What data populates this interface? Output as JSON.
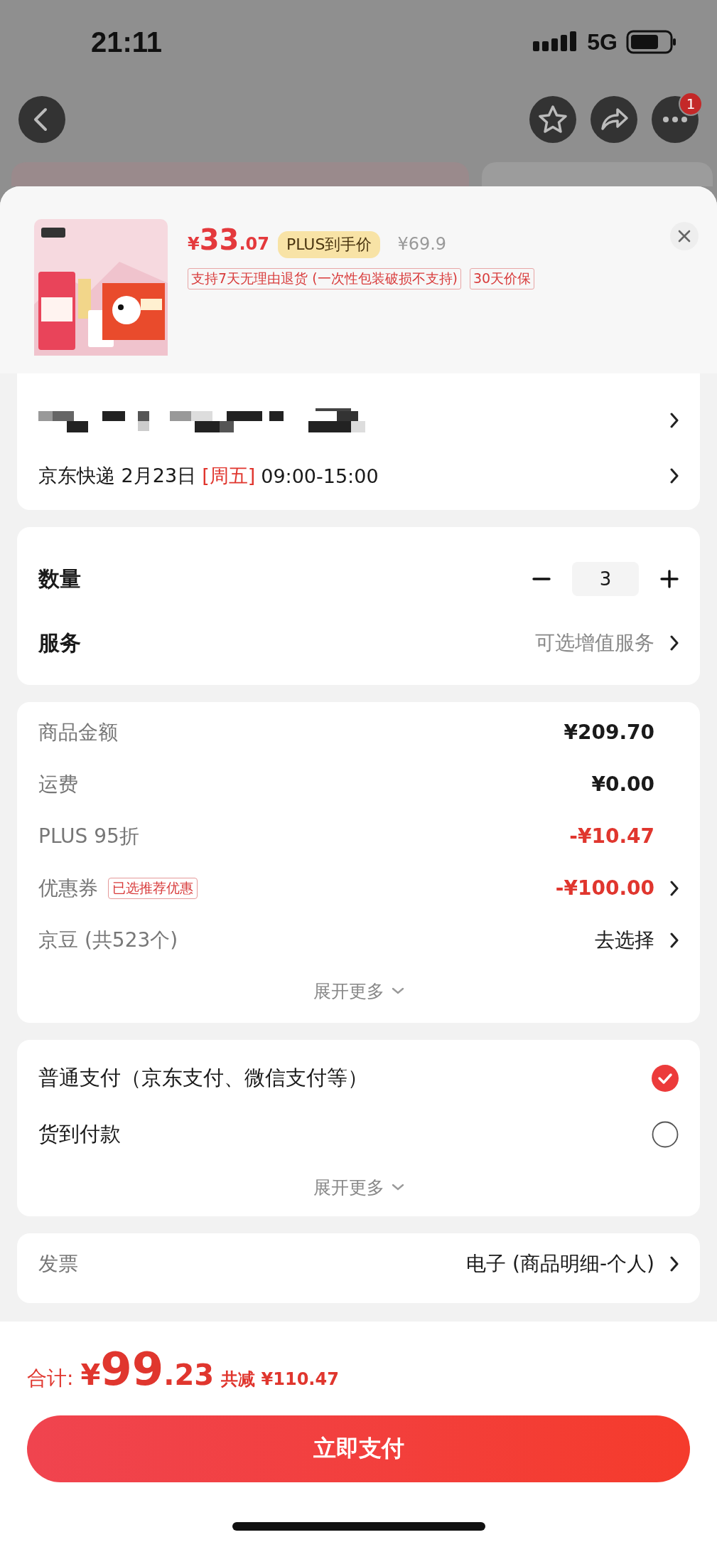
{
  "status_bar": {
    "time": "21:11",
    "network": "5G"
  },
  "nav": {
    "notification_badge": "1"
  },
  "product": {
    "currency": "¥",
    "price_integer": "33",
    "price_decimal": ".07",
    "price_label": "PLUS到手价",
    "original_price": "¥69.9",
    "tags": [
      "支持7天无理由退货 (一次性包装破损不支持)",
      "30天价保"
    ]
  },
  "delivery": {
    "carrier_date": "京东快递 2月23日",
    "weekday": "[周五]",
    "time_window": "09:00-15:00"
  },
  "quantity": {
    "label": "数量",
    "value": "3"
  },
  "service": {
    "label": "服务",
    "value": "可选增值服务"
  },
  "price_rows": [
    {
      "label": "商品金额",
      "value": "¥209.70",
      "kind": "amount",
      "chevron": false
    },
    {
      "label": "运费",
      "value": "¥0.00",
      "kind": "amount",
      "chevron": false
    },
    {
      "label": "PLUS 95折",
      "value": "-¥10.47",
      "kind": "deduction",
      "chevron": false
    },
    {
      "label": "优惠券",
      "badge": "已选推荐优惠",
      "value": "-¥100.00",
      "kind": "deduction",
      "chevron": true
    },
    {
      "label": "京豆 (共523个)",
      "value": "去选择",
      "kind": "choice",
      "chevron": true
    }
  ],
  "price_expand": "展开更多",
  "payment_options": [
    {
      "label": "普通支付（京东支付、微信支付等）",
      "selected": true
    },
    {
      "label": "货到付款",
      "selected": false
    }
  ],
  "payment_expand": "展开更多",
  "invoice": {
    "label": "发票",
    "value": "电子 (商品明细-个人)"
  },
  "total": {
    "label": "合计:",
    "currency": "¥",
    "integer": "99",
    "decimal": ".23",
    "savings": "共减 ¥110.47"
  },
  "pay_button": "立即支付"
}
